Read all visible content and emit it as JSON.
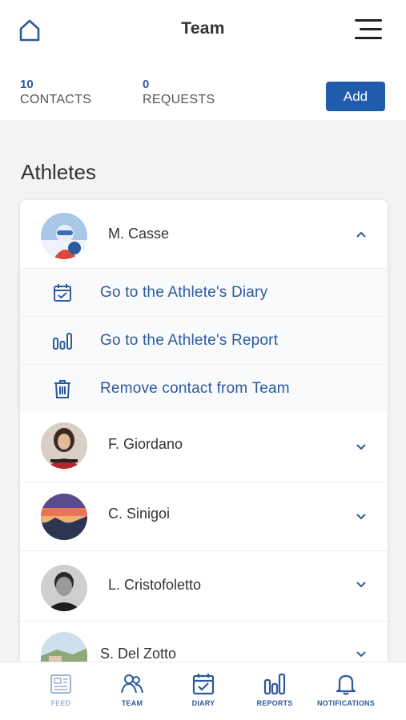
{
  "header": {
    "title": "Team",
    "home_icon": "home-icon",
    "menu_icon": "hamburger-menu-icon"
  },
  "stats": {
    "contacts_count": "10",
    "contacts_label": "CONTACTS",
    "requests_count": "0",
    "requests_label": "REQUESTS"
  },
  "add_button": {
    "label": "Add"
  },
  "section": {
    "title": "Athletes"
  },
  "athletes": [
    {
      "name": "M. Casse",
      "expanded": true
    },
    {
      "name": "F. Giordano",
      "expanded": false
    },
    {
      "name": "C. Sinigoi",
      "expanded": false
    },
    {
      "name": "L. Cristofoletto",
      "expanded": false
    },
    {
      "name": "S. Del Zotto",
      "expanded": false
    }
  ],
  "athlete_actions": [
    {
      "label": "Go to the Athlete's Diary",
      "icon": "calendar-check-icon"
    },
    {
      "label": "Go to the Athlete's Report",
      "icon": "bar-chart-icon"
    },
    {
      "label": "Remove contact from Team",
      "icon": "trash-icon"
    }
  ],
  "bottom_nav": [
    {
      "label": "FEED",
      "icon": "feed-icon"
    },
    {
      "label": "TEAM",
      "icon": "team-icon"
    },
    {
      "label": "DIARY",
      "icon": "calendar-check-icon"
    },
    {
      "label": "REPORTS",
      "icon": "bar-chart-icon"
    },
    {
      "label": "NOTIFICATIONS",
      "icon": "bell-icon"
    }
  ],
  "colors": {
    "accent": "#2d5a9c",
    "button": "#1f5cab",
    "background": "#f3f3f3"
  }
}
